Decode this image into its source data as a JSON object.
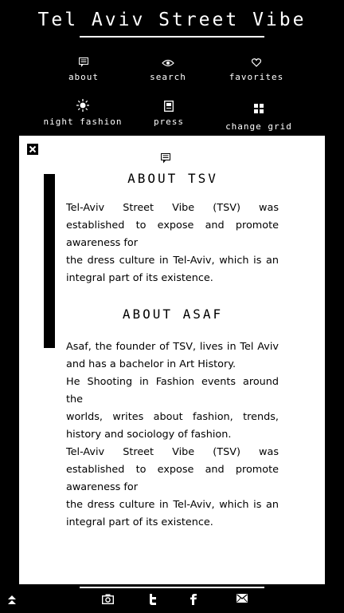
{
  "header": {
    "title": "Tel Aviv Street Vibe"
  },
  "nav": {
    "about": {
      "label": "about",
      "icon": "comment-icon"
    },
    "search": {
      "label": "search",
      "icon": "eye-icon"
    },
    "favorites": {
      "label": "favorites",
      "icon": "heart-icon"
    },
    "night_fashion": {
      "label": "night fashion",
      "icon": "sun-icon"
    },
    "press": {
      "label": "press",
      "icon": "newspaper-icon"
    },
    "change_grid": {
      "label": "change grid",
      "icon": "grid-icon"
    }
  },
  "panel": {
    "close_icon": "close-icon",
    "about_tsv": {
      "title": "ABOUT TSV",
      "line1": "Tel-Aviv Street Vibe (TSV) was",
      "line2": "established to expose and promote",
      "line3": "awareness for",
      "line4": "the dress culture in Tel-Aviv, which is an",
      "line5": "integral part of its existence."
    },
    "about_asaf": {
      "title": "ABOUT ASAF",
      "line1": "Asaf, the founder of TSV, lives in Tel Aviv",
      "line2": "and has a bachelor in Art History.",
      "line3": "He Shooting in Fashion events around the",
      "line4": "worlds, writes about fashion, trends,",
      "line5": "history and sociology of fashion."
    },
    "repeat": {
      "line1": "Tel-Aviv Street Vibe (TSV) was",
      "line2": "established to expose and promote",
      "line3": "awareness for",
      "line4": "the dress culture in Tel-Aviv, which is an",
      "line5": "integral part of its existence."
    }
  },
  "footer": {
    "icons": [
      "scroll-top-icon",
      "camera-icon",
      "twitter-icon",
      "facebook-icon",
      "mail-icon"
    ]
  },
  "colors": {
    "background": "#000000",
    "panel": "#ffffff",
    "text_light": "#ffffff",
    "text_dark": "#000000"
  }
}
